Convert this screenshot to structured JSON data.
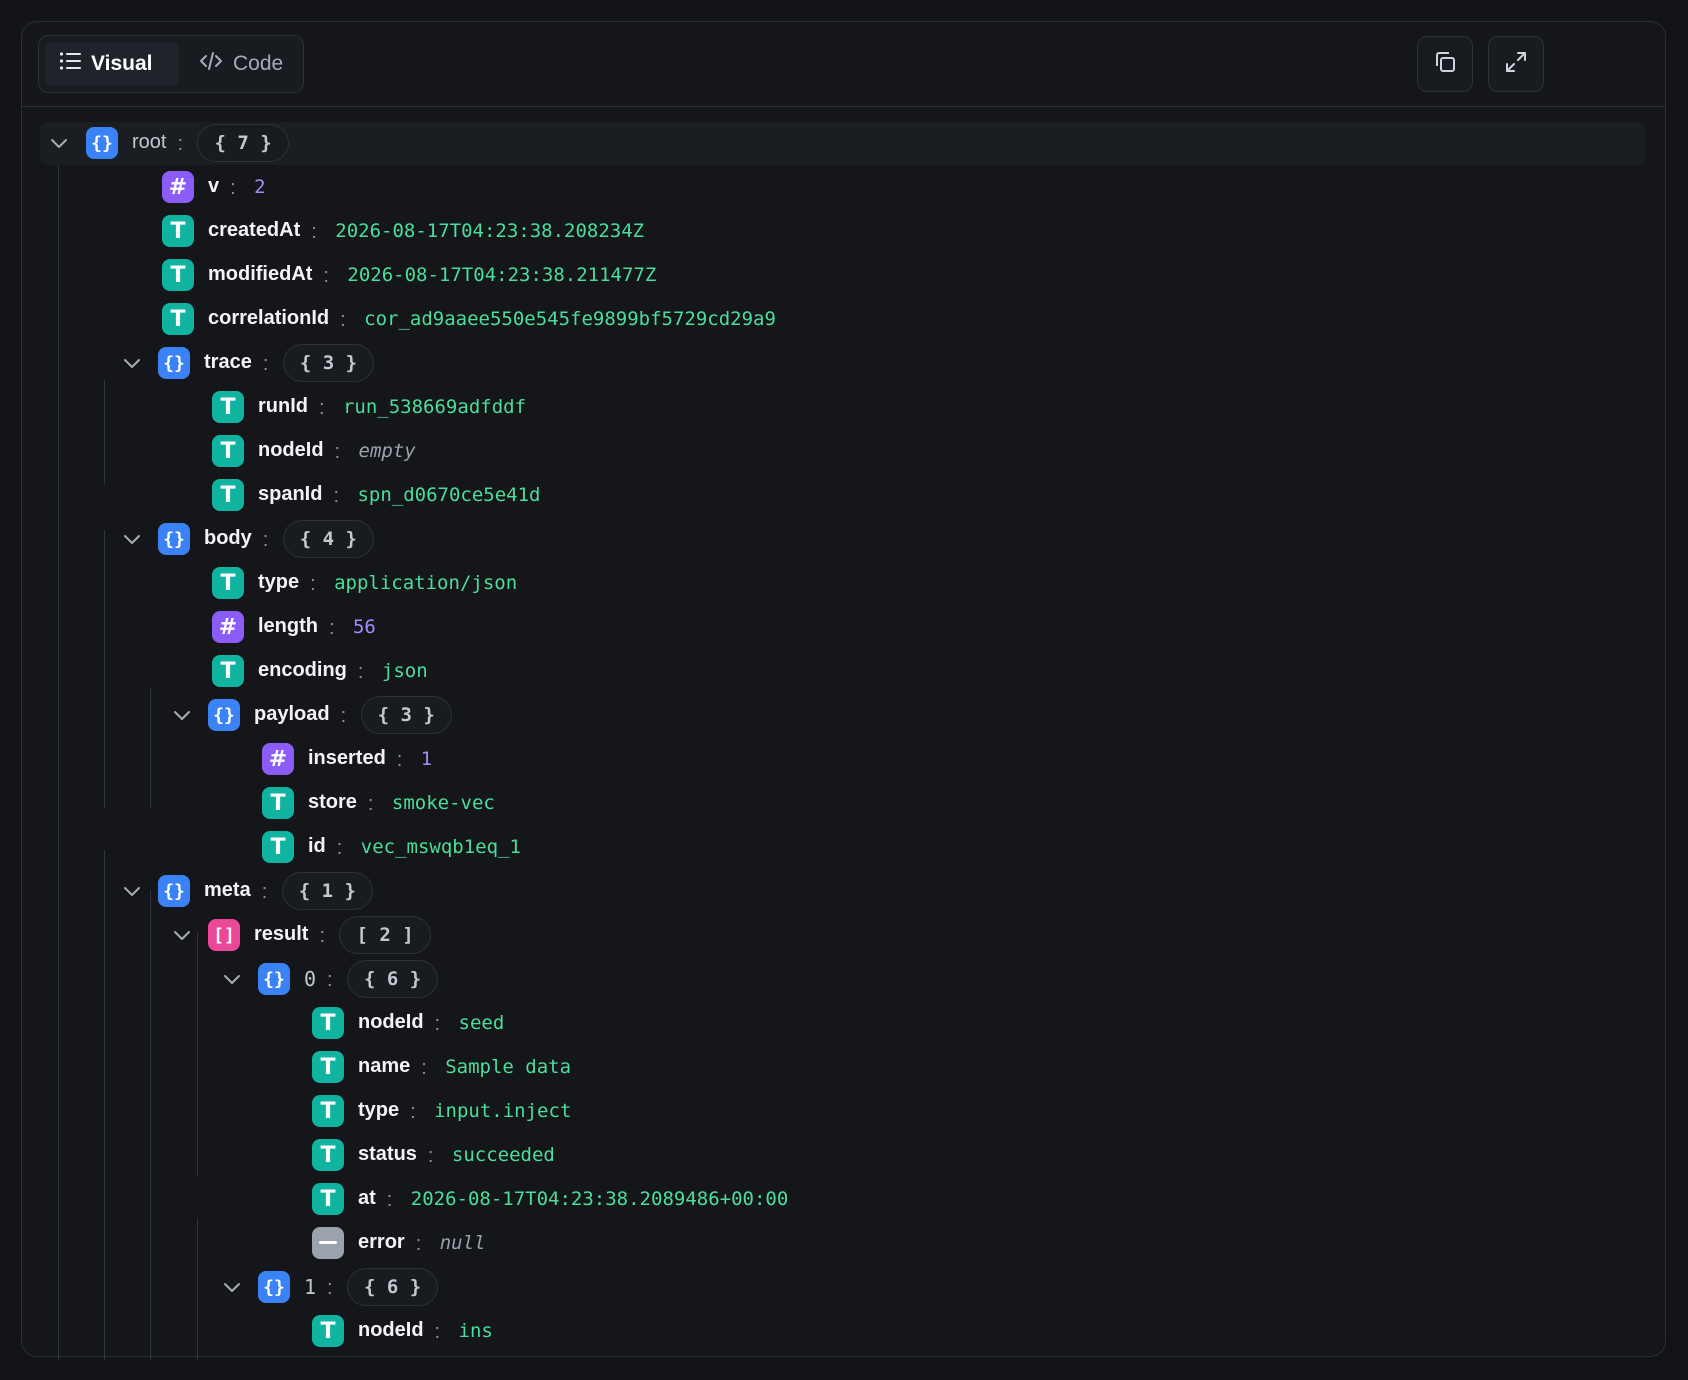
{
  "toolbar": {
    "visual_label": "Visual",
    "code_label": "Code"
  },
  "tree": {
    "root": {
      "key": "root",
      "count": "{ 7 }"
    },
    "v": {
      "key": "v",
      "value": "2"
    },
    "createdAt": {
      "key": "createdAt",
      "value": "2026-08-17T04:23:38.208234Z"
    },
    "modifiedAt": {
      "key": "modifiedAt",
      "value": "2026-08-17T04:23:38.211477Z"
    },
    "correlationId": {
      "key": "correlationId",
      "value": "cor_ad9aaee550e545fe9899bf5729cd29a9"
    },
    "trace": {
      "key": "trace",
      "count": "{ 3 }"
    },
    "runId": {
      "key": "runId",
      "value": "run_538669adfddf"
    },
    "trace_nodeId": {
      "key": "nodeId",
      "value": "empty"
    },
    "spanId": {
      "key": "spanId",
      "value": "spn_d0670ce5e41d"
    },
    "body": {
      "key": "body",
      "count": "{ 4 }"
    },
    "body_type": {
      "key": "type",
      "value": "application/json"
    },
    "length": {
      "key": "length",
      "value": "56"
    },
    "encoding": {
      "key": "encoding",
      "value": "json"
    },
    "payload": {
      "key": "payload",
      "count": "{ 3 }"
    },
    "inserted": {
      "key": "inserted",
      "value": "1"
    },
    "store": {
      "key": "store",
      "value": "smoke-vec"
    },
    "id": {
      "key": "id",
      "value": "vec_mswqb1eq_1"
    },
    "meta": {
      "key": "meta",
      "count": "{ 1 }"
    },
    "result": {
      "key": "result",
      "count": "[ 2 ]"
    },
    "item0": {
      "key": "0",
      "count": "{ 6 }"
    },
    "item0_nodeId": {
      "key": "nodeId",
      "value": "seed"
    },
    "item0_name": {
      "key": "name",
      "value": "Sample data"
    },
    "item0_type": {
      "key": "type",
      "value": "input.inject"
    },
    "item0_status": {
      "key": "status",
      "value": "succeeded"
    },
    "item0_at": {
      "key": "at",
      "value": "2026-08-17T04:23:38.2089486+00:00"
    },
    "item0_error": {
      "key": "error",
      "value": "null"
    },
    "item1": {
      "key": "1",
      "count": "{ 6 }"
    },
    "item1_nodeId": {
      "key": "nodeId",
      "value": "ins"
    }
  },
  "colors": {
    "object": "#3b82f6",
    "number": "#8b5cf6",
    "string": "#10b3a0",
    "array": "#ec4899",
    "null": "#9aa2ae",
    "string_value": "#4ade9a",
    "number_value": "#a78bfa"
  },
  "icons": {
    "visual": "list-icon",
    "code": "code-icon",
    "copy": "copy-icon",
    "expand": "expand-icon",
    "chevron": "chevron-down-icon"
  }
}
